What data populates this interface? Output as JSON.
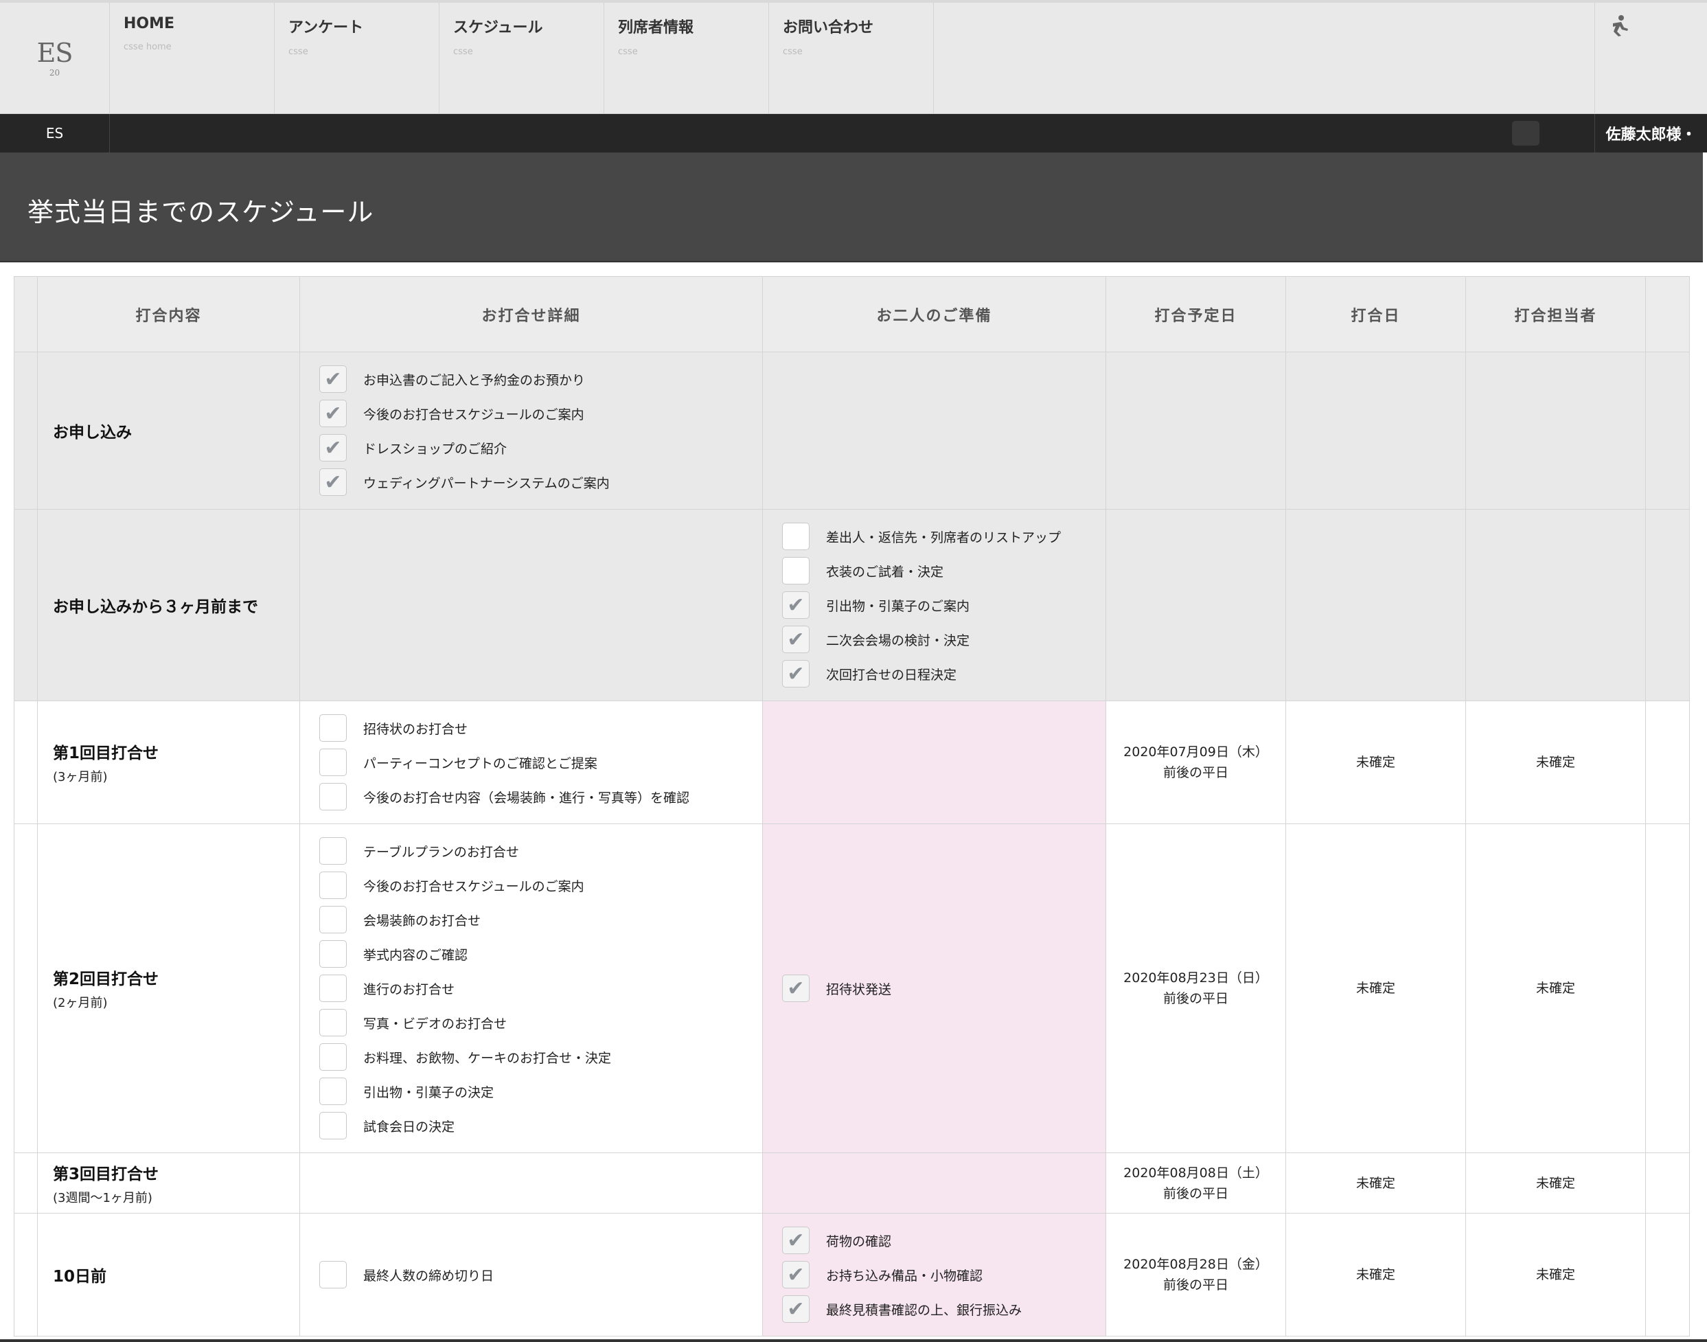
{
  "logo": {
    "mark": "ES",
    "sub": "20"
  },
  "nav": [
    {
      "title": "HOME",
      "sub": "csse home"
    },
    {
      "title": "アンケート",
      "sub": "csse"
    },
    {
      "title": "スケジュール",
      "sub": "csse"
    },
    {
      "title": "列席者情報",
      "sub": "csse"
    },
    {
      "title": "お問い合わせ",
      "sub": "csse"
    }
  ],
  "bar": {
    "brand": "ES",
    "user": "佐藤太郎様・"
  },
  "page": {
    "title": "挙式当日までのスケジュール"
  },
  "table": {
    "headers": [
      "打合内容",
      "お打合せ詳細",
      "お二人のご準備",
      "打合予定日",
      "打合日",
      "打合担当者"
    ],
    "rows": [
      {
        "title": "お申し込み",
        "subtitle": "",
        "details": [
          {
            "label": "お申込書のご記入と予約金のお預かり",
            "checked": true
          },
          {
            "label": "今後のお打合せスケジュールのご案内",
            "checked": true
          },
          {
            "label": "ドレスショップのご紹介",
            "checked": true
          },
          {
            "label": "ウェディングパートナーシステムのご案内",
            "checked": true
          }
        ],
        "prep": [],
        "date_line1": "",
        "date_line2": "",
        "meeting_date": "",
        "staff": ""
      },
      {
        "title": "お申し込みから３ヶ月前まで",
        "subtitle": "",
        "details": [],
        "prep": [
          {
            "label": "差出人・返信先・列席者のリストアップ",
            "checked": false
          },
          {
            "label": "衣装のご試着・決定",
            "checked": false
          },
          {
            "label": "引出物・引菓子のご案内",
            "checked": true
          },
          {
            "label": "二次会会場の検討・決定",
            "checked": true
          },
          {
            "label": "次回打合せの日程決定",
            "checked": true
          }
        ],
        "date_line1": "",
        "date_line2": "",
        "meeting_date": "",
        "staff": ""
      },
      {
        "title": "第1回目打合せ",
        "subtitle": "(3ヶ月前)",
        "details": [
          {
            "label": "招待状のお打合せ",
            "checked": false
          },
          {
            "label": "パーティーコンセプトのご確認とご提案",
            "checked": false
          },
          {
            "label": "今後のお打合せ内容（会場装飾・進行・写真等）を確認",
            "checked": false
          }
        ],
        "prep": [],
        "date_line1": "2020年07月09日（木）",
        "date_line2": "前後の平日",
        "meeting_date": "未確定",
        "staff": "未確定"
      },
      {
        "title": "第2回目打合せ",
        "subtitle": "(2ヶ月前)",
        "details": [
          {
            "label": "テーブルプランのお打合せ",
            "checked": false
          },
          {
            "label": "今後のお打合せスケジュールのご案内",
            "checked": false
          },
          {
            "label": "会場装飾のお打合せ",
            "checked": false
          },
          {
            "label": "挙式内容のご確認",
            "checked": false
          },
          {
            "label": "進行のお打合せ",
            "checked": false
          },
          {
            "label": "写真・ビデオのお打合せ",
            "checked": false
          },
          {
            "label": "お料理、お飲物、ケーキのお打合せ・決定",
            "checked": false
          },
          {
            "label": "引出物・引菓子の決定",
            "checked": false
          },
          {
            "label": "試食会日の決定",
            "checked": false
          }
        ],
        "prep": [
          {
            "label": "招待状発送",
            "checked": true
          }
        ],
        "date_line1": "2020年08月23日（日）",
        "date_line2": "前後の平日",
        "meeting_date": "未確定",
        "staff": "未確定"
      },
      {
        "title": "第3回目打合せ",
        "subtitle": "(3週間〜1ヶ月前)",
        "details": [],
        "prep": [],
        "date_line1": "2020年08月08日（土）",
        "date_line2": "前後の平日",
        "meeting_date": "未確定",
        "staff": "未確定"
      },
      {
        "title": "10日前",
        "subtitle": "",
        "details": [
          {
            "label": "最終人数の締め切り日",
            "checked": false
          }
        ],
        "prep": [
          {
            "label": "荷物の確認",
            "checked": true
          },
          {
            "label": "お持ち込み備品・小物確認",
            "checked": true
          },
          {
            "label": "最終見積書確認の上、銀行振込み",
            "checked": true
          }
        ],
        "date_line1": "2020年08月28日（金）",
        "date_line2": "前後の平日",
        "meeting_date": "未確定",
        "staff": "未確定"
      }
    ]
  },
  "icons": {
    "check": "check-mark-icon",
    "user_menu": "user-figure-icon"
  }
}
